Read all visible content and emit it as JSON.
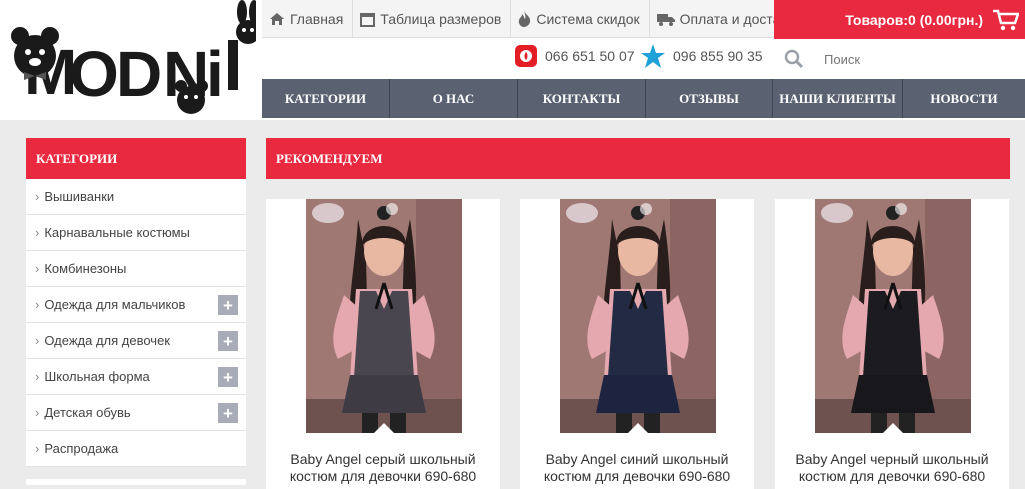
{
  "logo": {
    "text": "MODNiKi"
  },
  "toplinks": [
    {
      "label": "Главная",
      "icon": "home-icon"
    },
    {
      "label": "Таблица размеров",
      "icon": "calendar-icon"
    },
    {
      "label": "Система скидок",
      "icon": "flame-icon"
    },
    {
      "label": "Оплата и доставка",
      "icon": "truck-icon"
    }
  ],
  "cart": {
    "label": "Товаров:0 (0.00грн.)",
    "icon": "cart-icon"
  },
  "phones": [
    {
      "number": "066 651 50 07",
      "icon": "vodafone-icon"
    },
    {
      "number": "096 855 90 35",
      "icon": "kyivstar-star-icon"
    }
  ],
  "search": {
    "placeholder": "Поиск"
  },
  "nav": [
    "КАТЕГОРИИ",
    "О НАС",
    "КОНТАКТЫ",
    "ОТЗЫВЫ",
    "НАШИ КЛИЕНТЫ",
    "НОВОСТИ"
  ],
  "sidebar": {
    "title": "КАТЕГОРИИ",
    "items": [
      {
        "label": "Вышиванки",
        "expandable": false
      },
      {
        "label": "Карнавальные костюмы",
        "expandable": false
      },
      {
        "label": "Комбинезоны",
        "expandable": false
      },
      {
        "label": "Одежда для мальчиков",
        "expandable": true
      },
      {
        "label": "Одежда для девочек",
        "expandable": true
      },
      {
        "label": "Школьная форма",
        "expandable": true
      },
      {
        "label": "Детская обувь",
        "expandable": true
      },
      {
        "label": "Распродажа",
        "expandable": false
      }
    ]
  },
  "main": {
    "title": "РЕКОМЕНДУЕМ",
    "products": [
      {
        "title": "Baby Angel серый школьный костюм для девочки 690-680",
        "vest_color": "#4a4650",
        "skirt_color": "#3f3b45"
      },
      {
        "title": "Baby Angel синий школьный костюм для девочки 690-680",
        "vest_color": "#232a44",
        "skirt_color": "#1e2440"
      },
      {
        "title": "Baby Angel черный школьный костюм для девочки 690-680",
        "vest_color": "#1c1b20",
        "skirt_color": "#18171b"
      }
    ]
  },
  "colors": {
    "accent": "#e8293f",
    "nav": "#5a6170",
    "plus": "#a7acb6"
  }
}
